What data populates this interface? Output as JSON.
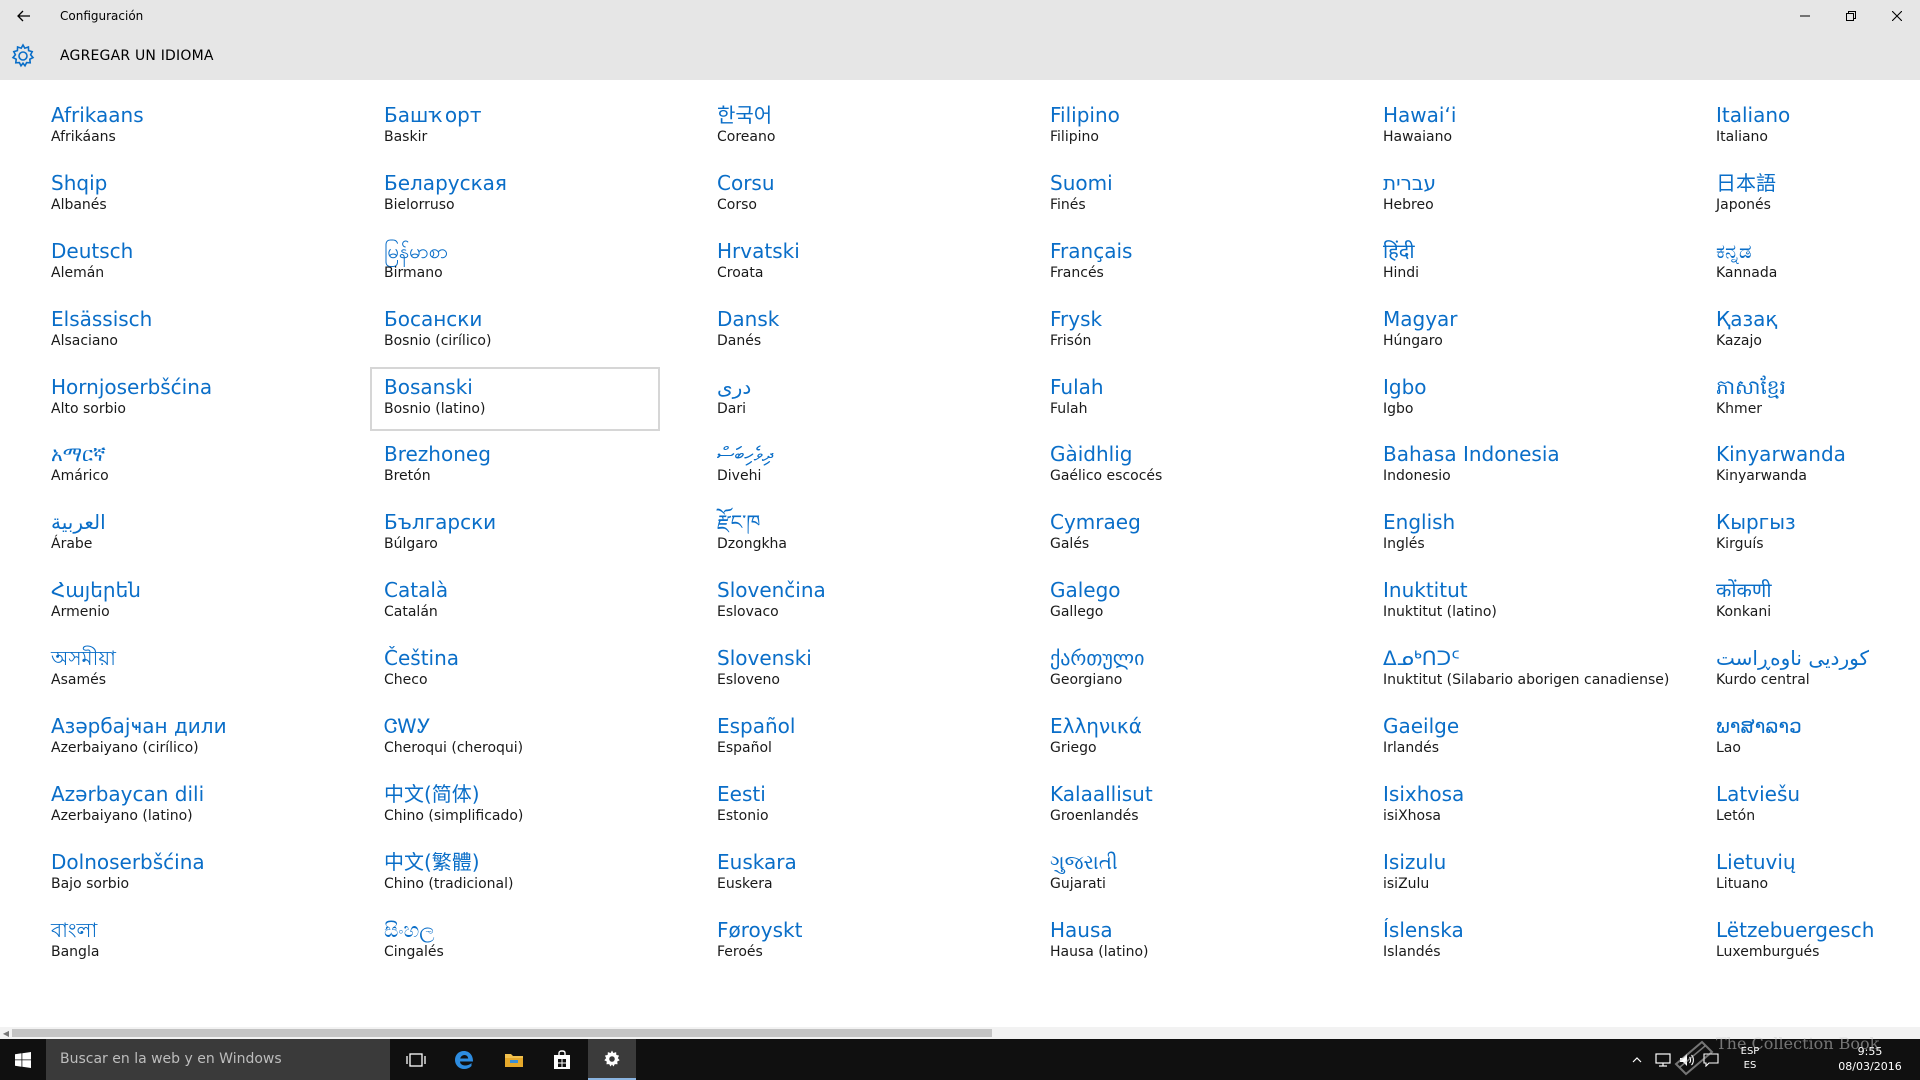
{
  "window": {
    "title": "Configuración"
  },
  "header": {
    "title": "AGREGAR UN IDIOMA"
  },
  "languages": [
    {
      "native": "Afrikaans",
      "spanish": "Afrikáans"
    },
    {
      "native": "Shqip",
      "spanish": "Albanés"
    },
    {
      "native": "Deutsch",
      "spanish": "Alemán"
    },
    {
      "native": "Elsässisch",
      "spanish": "Alsaciano"
    },
    {
      "native": "Hornjoserbšćina",
      "spanish": "Alto sorbio"
    },
    {
      "native": "አማርኛ",
      "spanish": "Amárico"
    },
    {
      "native": "العربية",
      "spanish": "Árabe"
    },
    {
      "native": "Հայերեն",
      "spanish": "Armenio"
    },
    {
      "native": "অসমীয়া",
      "spanish": "Asamés"
    },
    {
      "native": "Азәрбајҹан дили",
      "spanish": "Azerbaiyano (cirílico)"
    },
    {
      "native": "Azərbaycan dili",
      "spanish": "Azerbaiyano (latino)"
    },
    {
      "native": "Dolnoserbšćina",
      "spanish": "Bajo sorbio"
    },
    {
      "native": "বাংলা",
      "spanish": "Bangla"
    },
    {
      "native": "Башҡорт",
      "spanish": "Baskir"
    },
    {
      "native": "Беларуская",
      "spanish": "Bielorruso"
    },
    {
      "native": "မြန်မာစာ",
      "spanish": "Birmano"
    },
    {
      "native": "Босански",
      "spanish": "Bosnio (cirílico)"
    },
    {
      "native": "Bosanski",
      "spanish": "Bosnio (latino)",
      "selected": true
    },
    {
      "native": "Brezhoneg",
      "spanish": "Bretón"
    },
    {
      "native": "Български",
      "spanish": "Búlgaro"
    },
    {
      "native": "Català",
      "spanish": "Catalán"
    },
    {
      "native": "Čeština",
      "spanish": "Checo"
    },
    {
      "native": "ᏣᎳᎩ",
      "spanish": "Cheroqui (cheroqui)"
    },
    {
      "native": "中文(简体)",
      "spanish": "Chino (simplificado)"
    },
    {
      "native": "中文(繁體)",
      "spanish": "Chino (tradicional)"
    },
    {
      "native": "සිංහල",
      "spanish": "Cingalés"
    },
    {
      "native": "한국어",
      "spanish": "Coreano"
    },
    {
      "native": "Corsu",
      "spanish": "Corso"
    },
    {
      "native": "Hrvatski",
      "spanish": "Croata"
    },
    {
      "native": "Dansk",
      "spanish": "Danés"
    },
    {
      "native": "دری",
      "spanish": "Dari"
    },
    {
      "native": "ދިވެހިބަސް",
      "spanish": "Divehi"
    },
    {
      "native": "རྫོང་ཁ",
      "spanish": "Dzongkha"
    },
    {
      "native": "Slovenčina",
      "spanish": "Eslovaco"
    },
    {
      "native": "Slovenski",
      "spanish": "Esloveno"
    },
    {
      "native": "Español",
      "spanish": "Español"
    },
    {
      "native": "Eesti",
      "spanish": "Estonio"
    },
    {
      "native": "Euskara",
      "spanish": "Euskera"
    },
    {
      "native": "Føroyskt",
      "spanish": "Feroés"
    },
    {
      "native": "Filipino",
      "spanish": "Filipino"
    },
    {
      "native": "Suomi",
      "spanish": "Finés"
    },
    {
      "native": "Français",
      "spanish": "Francés"
    },
    {
      "native": "Frysk",
      "spanish": "Frisón"
    },
    {
      "native": "Fulah",
      "spanish": "Fulah"
    },
    {
      "native": "Gàidhlig",
      "spanish": "Gaélico escocés"
    },
    {
      "native": "Cymraeg",
      "spanish": "Galés"
    },
    {
      "native": "Galego",
      "spanish": "Gallego"
    },
    {
      "native": "ქართული",
      "spanish": "Georgiano"
    },
    {
      "native": "Ελληνικά",
      "spanish": "Griego"
    },
    {
      "native": "Kalaallisut",
      "spanish": "Groenlandés"
    },
    {
      "native": "ગુજરાતી",
      "spanish": "Gujarati"
    },
    {
      "native": "Hausa",
      "spanish": "Hausa (latino)"
    },
    {
      "native": "Hawaiʻi",
      "spanish": "Hawaiano"
    },
    {
      "native": "עברית",
      "spanish": "Hebreo"
    },
    {
      "native": "हिंदी",
      "spanish": "Hindi"
    },
    {
      "native": "Magyar",
      "spanish": "Húngaro"
    },
    {
      "native": "Igbo",
      "spanish": "Igbo"
    },
    {
      "native": "Bahasa Indonesia",
      "spanish": "Indonesio"
    },
    {
      "native": "English",
      "spanish": "Inglés"
    },
    {
      "native": "Inuktitut",
      "spanish": "Inuktitut (latino)"
    },
    {
      "native": "ᐃᓄᒃᑎᑐᑦ",
      "spanish": "Inuktitut (Silabario aborigen canadiense)"
    },
    {
      "native": "Gaeilge",
      "spanish": "Irlandés"
    },
    {
      "native": "Isixhosa",
      "spanish": "isiXhosa"
    },
    {
      "native": "Isizulu",
      "spanish": "isiZulu"
    },
    {
      "native": "Íslenska",
      "spanish": "Islandés"
    },
    {
      "native": "Italiano",
      "spanish": "Italiano"
    },
    {
      "native": "日本語",
      "spanish": "Japonés"
    },
    {
      "native": "ಕನ್ನಡ",
      "spanish": "Kannada"
    },
    {
      "native": "Қазақ",
      "spanish": "Kazajo"
    },
    {
      "native": "ភាសាខ្មែរ",
      "spanish": "Khmer"
    },
    {
      "native": "Kinyarwanda",
      "spanish": "Kinyarwanda"
    },
    {
      "native": "Кыргыз",
      "spanish": "Kirguís"
    },
    {
      "native": "कोंकणी",
      "spanish": "Konkani"
    },
    {
      "native": "کوردیی ناوەڕاست",
      "spanish": "Kurdo central"
    },
    {
      "native": "ພາສາລາວ",
      "spanish": "Lao"
    },
    {
      "native": "Latviešu",
      "spanish": "Letón"
    },
    {
      "native": "Lietuvių",
      "spanish": "Lituano"
    },
    {
      "native": "Lëtzebuergesch",
      "spanish": "Luxemburgués"
    }
  ],
  "taskbar": {
    "search_placeholder": "Buscar en la web y en Windows",
    "lang_code": "ESP",
    "lang_sub": "ES",
    "time": "9:55",
    "date": "08/03/2016"
  },
  "watermark": "The Collection Book",
  "colors": {
    "accent": "#0a6ec8",
    "chrome": "#e6e6e6",
    "taskbar": "#101010"
  }
}
